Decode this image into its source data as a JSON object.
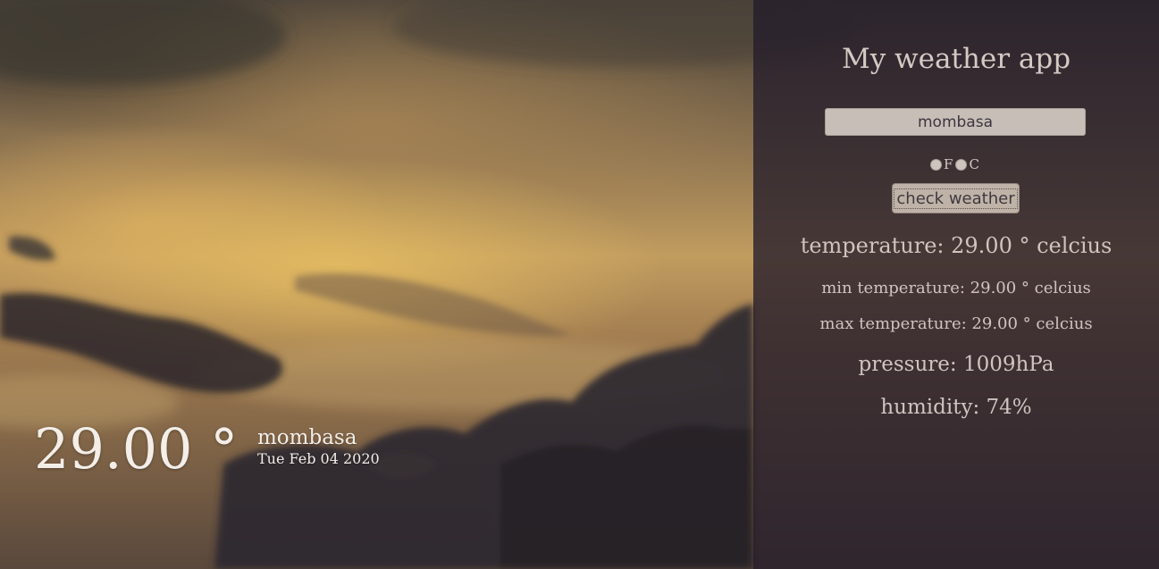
{
  "app": {
    "title": "My weather app"
  },
  "search": {
    "value": "mombasa"
  },
  "units": {
    "fahrenheit_label": "F",
    "celsius_label": "C",
    "selected": null
  },
  "actions": {
    "check_label": "check weather"
  },
  "details": {
    "temperature": "temperature: 29.00 ° celcius",
    "min_temperature": "min temperature: 29.00 ° celcius",
    "max_temperature": "max temperature: 29.00 ° celcius",
    "pressure": "pressure: 1009hPa",
    "humidity": "humidity: 74%"
  },
  "current": {
    "temperature": "29.00 °",
    "city": "mombasa",
    "date": "Tue Feb 04 2020"
  },
  "colors": {
    "panel_background": "#241c2a",
    "panel_text": "#cfc4c0",
    "sky_highlight": "#e7be62",
    "cloud_dark": "#2e2730"
  }
}
